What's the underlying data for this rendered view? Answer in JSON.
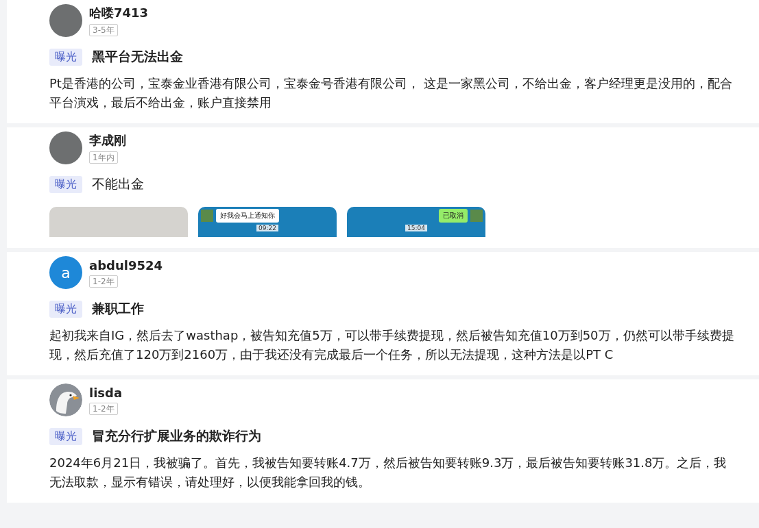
{
  "posts": [
    {
      "avatar": {
        "kind": "photo"
      },
      "username": "哈喽7413",
      "tenure": "3-5年",
      "tag": "曝光",
      "title": "黑平台无法出金",
      "title_bold": true,
      "body": "Pt是香港的公司，宝泰金业香港有限公司，宝泰金号香港有限公司， 这是一家黑公司，不给出金，客户经理更是没用的，配合平台演戏，最后不给出金，账户直接禁用"
    },
    {
      "avatar": {
        "kind": "photo"
      },
      "username": "李成刚",
      "tenure": "1年内",
      "tag": "曝光",
      "title": "不能出金",
      "title_bold": false,
      "images": [
        {
          "kind": "plain"
        },
        {
          "kind": "chat",
          "bubble": "好我会马上通知你",
          "time": "09:22",
          "incoming": true
        },
        {
          "kind": "chat",
          "bubble": "已取消",
          "time": "15:04",
          "incoming": false
        }
      ]
    },
    {
      "avatar": {
        "kind": "letter",
        "letter": "a"
      },
      "username": "abdul9524",
      "tenure": "1-2年",
      "tag": "曝光",
      "title": "兼职工作",
      "title_bold": true,
      "body": "起初我来自IG，然后去了wasthap，被告知充值5万，可以带手续费提现，然后被告知充值10万到50万，仍然可以带手续费提现，然后充值了120万到2160万，由于我还没有完成最后一个任务，所以无法提现，这种方法是以PT C"
    },
    {
      "avatar": {
        "kind": "eagle"
      },
      "username": "lisda",
      "tenure": "1-2年",
      "tag": "曝光",
      "title": "冒充分行扩展业务的欺诈行为",
      "title_bold": true,
      "body": "2024年6月21日，我被骗了。首先，我被告知要转账4.7万，然后被告知要转账9.3万，最后被告知要转账31.8万。之后，我无法取款，显示有错误，请处理好，以便我能拿回我的钱。"
    }
  ]
}
